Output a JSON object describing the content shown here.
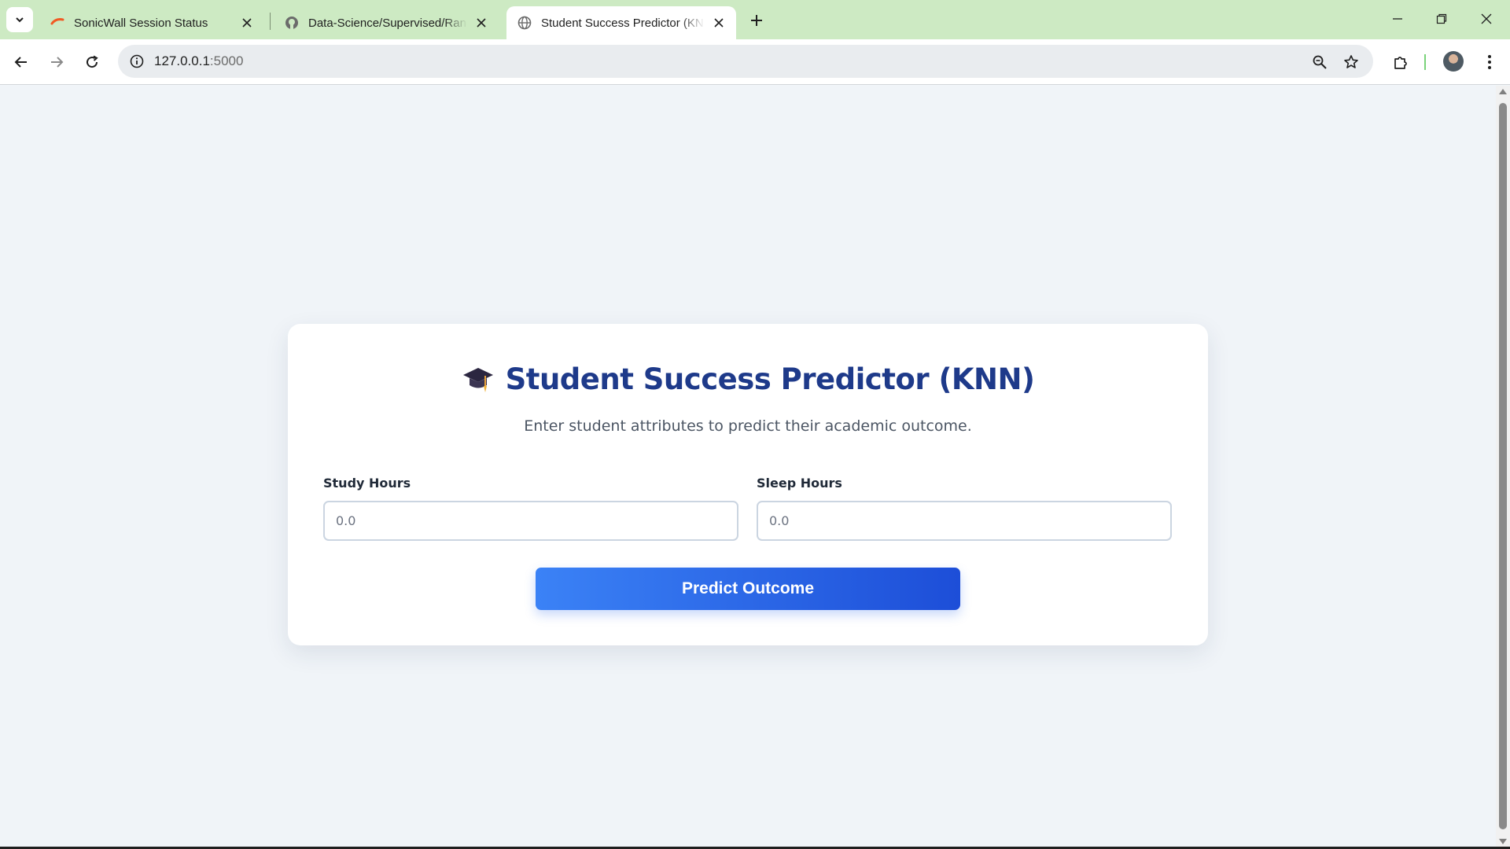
{
  "browser": {
    "tabs": [
      {
        "title": "SonicWall Session Status",
        "favicon": "sonicwall-icon",
        "active": false
      },
      {
        "title": "Data-Science/Supervised/Random",
        "favicon": "github-icon",
        "active": false
      },
      {
        "title": "Student Success Predictor (KNN)",
        "favicon": "globe-icon",
        "active": true
      }
    ],
    "address": {
      "host": "127.0.0.1",
      "port": ":5000"
    },
    "colors": {
      "tabstrip": "#cdeac3",
      "toolbar": "#ffffff"
    }
  },
  "page": {
    "title": "Student Success Predictor (KNN)",
    "title_icon": "graduation-cap-icon",
    "subtitle": "Enter student attributes to predict their academic outcome.",
    "fields": [
      {
        "label": "Study Hours",
        "placeholder": "0.0"
      },
      {
        "label": "Sleep Hours",
        "placeholder": "0.0"
      }
    ],
    "submit_label": "Predict Outcome",
    "colors": {
      "title": "#1e3a8a",
      "button_start": "#3b82f6",
      "button_end": "#1d4ed8",
      "background": "#f0f4f8"
    }
  }
}
